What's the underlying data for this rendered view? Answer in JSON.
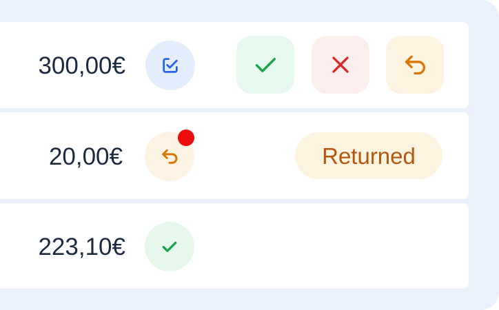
{
  "rows": [
    {
      "amount": "300,00€",
      "status_icon": "edit-check-icon",
      "actions": [
        {
          "name": "approve",
          "icon": "check-icon",
          "color": "#16a34a"
        },
        {
          "name": "reject",
          "icon": "close-icon",
          "color": "#dc2626"
        },
        {
          "name": "return",
          "icon": "return-arrow-icon",
          "color": "#d97706"
        }
      ]
    },
    {
      "amount": "20,00€",
      "status_icon": "return-arrow-icon",
      "has_notification": true,
      "badge": "Returned"
    },
    {
      "amount": "223,10€",
      "status_icon": "check-icon"
    }
  ],
  "colors": {
    "panel_bg": "#eaf1fd",
    "approve": "#16a34a",
    "reject": "#dc2626",
    "return": "#d97706",
    "edit": "#2563eb",
    "notification": "#ee0d0d"
  }
}
